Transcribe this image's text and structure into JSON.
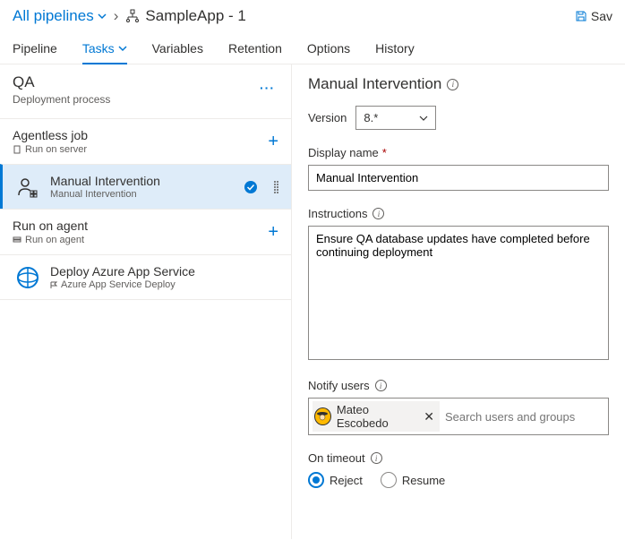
{
  "breadcrumb": {
    "root": "All pipelines",
    "current": "SampleApp - 1"
  },
  "header": {
    "save": "Sav"
  },
  "tabs": [
    "Pipeline",
    "Tasks",
    "Variables",
    "Retention",
    "Options",
    "History"
  ],
  "stage": {
    "title": "QA",
    "sub": "Deployment process"
  },
  "jobs": [
    {
      "title": "Agentless job",
      "sub": "Run on server"
    },
    {
      "title": "Run on agent",
      "sub": "Run on agent"
    }
  ],
  "tasks": {
    "manual": {
      "title": "Manual Intervention",
      "sub": "Manual Intervention"
    },
    "deploy": {
      "title": "Deploy Azure App Service",
      "sub": "Azure App Service Deploy"
    }
  },
  "panel": {
    "title": "Manual Intervention",
    "version_label": "Version",
    "version_value": "8.*",
    "display_label": "Display name",
    "display_value": "Manual Intervention",
    "instructions_label": "Instructions",
    "instructions_value": "Ensure QA database updates have completed before continuing deployment",
    "notify_label": "Notify users",
    "notify_chip": "Mateo Escobedo",
    "notify_placeholder": "Search users and groups",
    "timeout_label": "On timeout",
    "timeout_reject": "Reject",
    "timeout_resume": "Resume"
  }
}
